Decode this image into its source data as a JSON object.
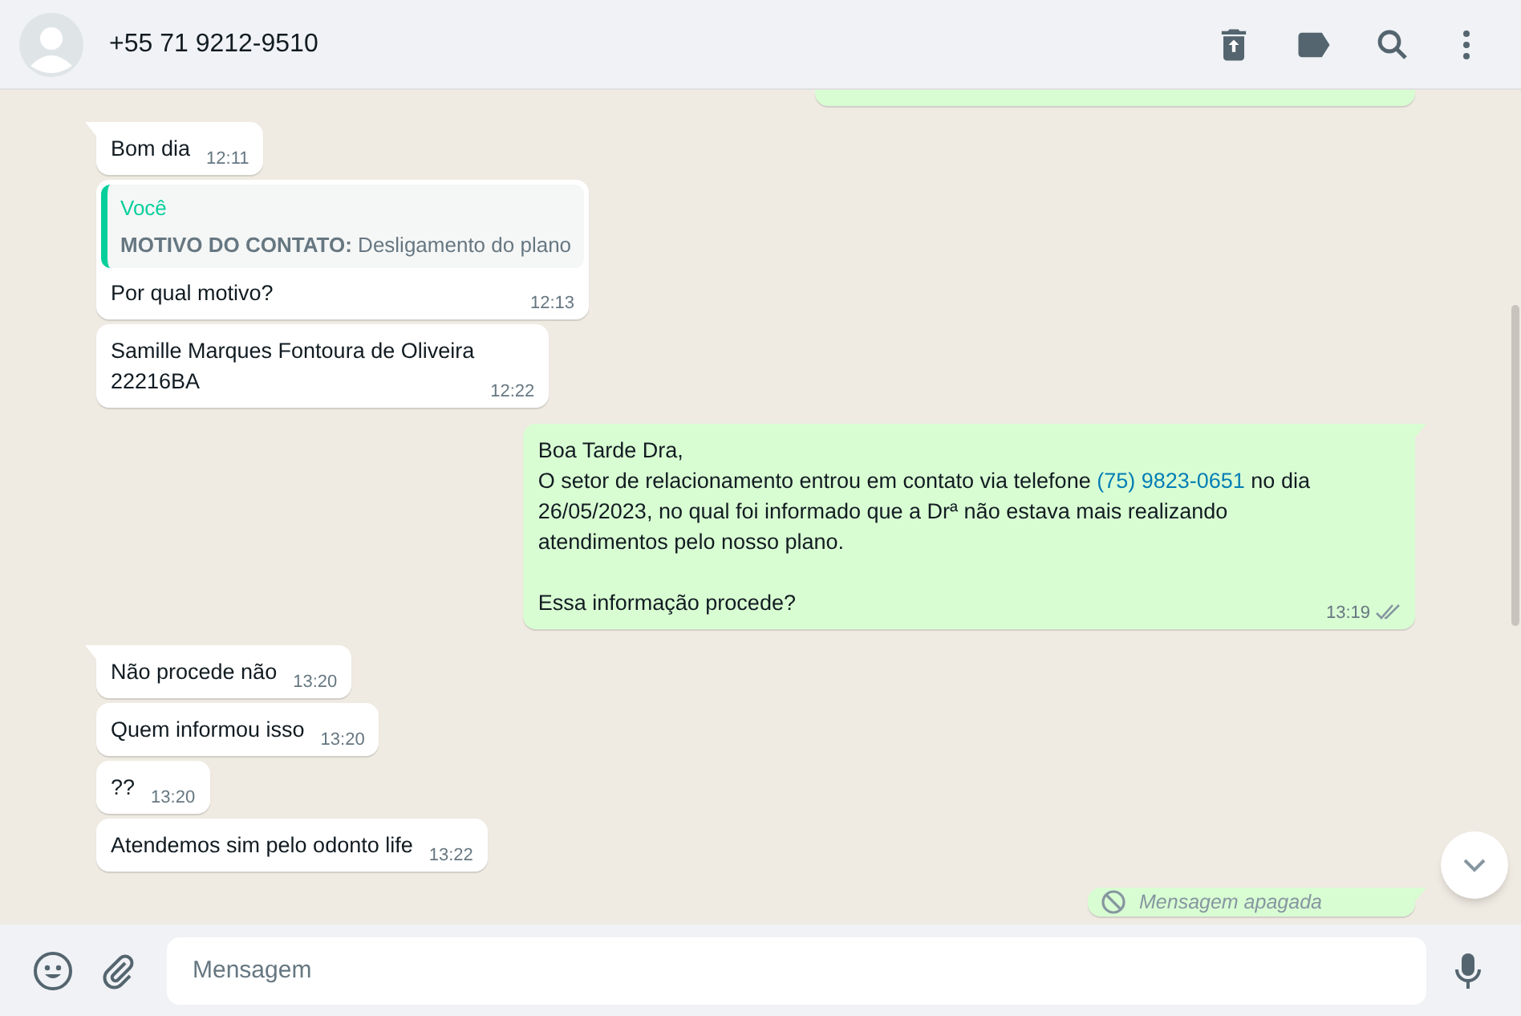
{
  "header": {
    "contact": "+55 71 9212-9510"
  },
  "messages": [
    {
      "kind": "cut",
      "outgoing": true
    },
    {
      "kind": "text",
      "outgoing": false,
      "parts": [
        {
          "text": "Bom dia"
        }
      ],
      "time": "12:11"
    },
    {
      "kind": "quoted",
      "outgoing": false,
      "quote": {
        "author": "Você",
        "label": "MOTIVO DO CONTATO:",
        "text": "Desligamento do plano"
      },
      "parts": [
        {
          "text": "Por qual motivo?"
        }
      ],
      "time": "12:13"
    },
    {
      "kind": "text",
      "outgoing": false,
      "parts": [
        {
          "text": "Samille Marques Fontoura de Oliveira\n22216BA"
        }
      ],
      "time": "12:22"
    },
    {
      "kind": "text",
      "outgoing": true,
      "read": false,
      "parts": [
        {
          "text": "Boa Tarde Dra,\nO setor de relacionamento entrou em contato via telefone "
        },
        {
          "text": "(75) 9823-0651",
          "kind": "link"
        },
        {
          "text": " no dia\n26/05/2023, no qual foi informado que a Drª não estava mais realizando\natendimentos pelo nosso plano.\n\nEssa informação procede?"
        }
      ],
      "time": "13:19"
    },
    {
      "kind": "text",
      "outgoing": false,
      "parts": [
        {
          "text": "Não procede não"
        }
      ],
      "time": "13:20"
    },
    {
      "kind": "text",
      "outgoing": false,
      "parts": [
        {
          "text": "Quem informou isso"
        }
      ],
      "time": "13:20"
    },
    {
      "kind": "text",
      "outgoing": false,
      "parts": [
        {
          "text": "??"
        }
      ],
      "time": "13:20"
    },
    {
      "kind": "text",
      "outgoing": false,
      "parts": [
        {
          "text": "Atendemos sim pelo odonto life"
        }
      ],
      "time": "13:22"
    },
    {
      "kind": "deleted",
      "outgoing": true,
      "text": "Mensagem apagada"
    }
  ],
  "composer": {
    "placeholder": "Mensagem"
  }
}
